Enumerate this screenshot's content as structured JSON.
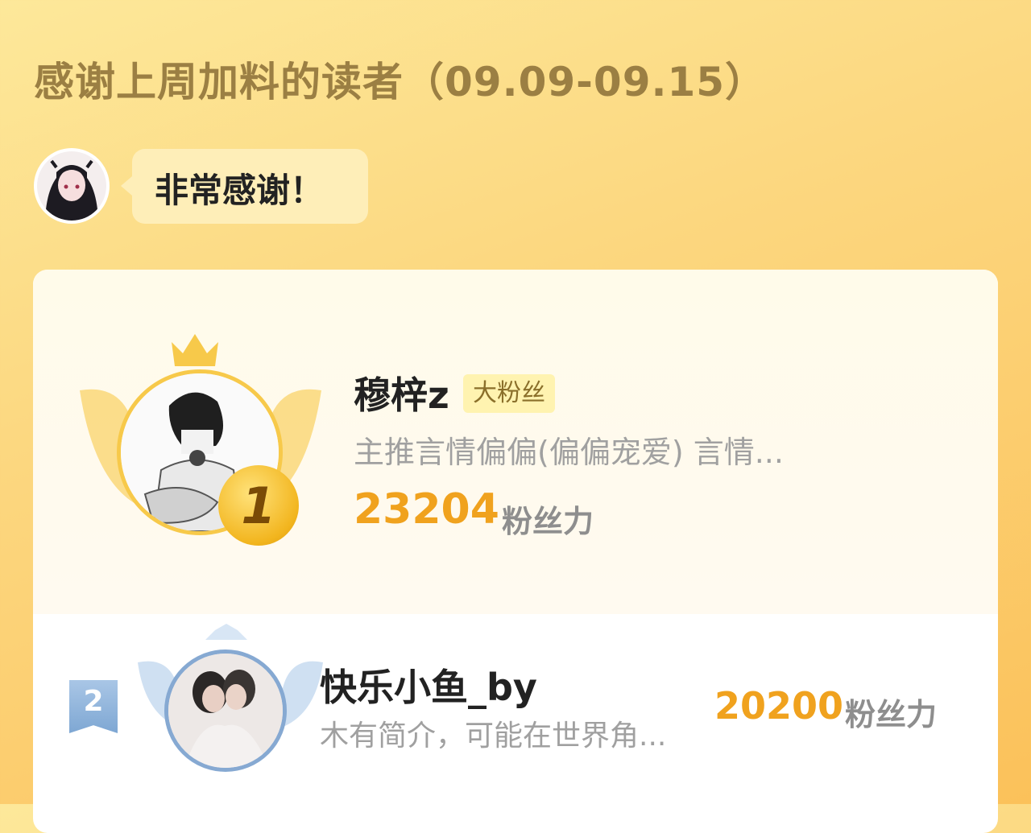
{
  "header": {
    "title": "感谢上周加料的读者（09.09-09.15）"
  },
  "author_message": {
    "text": "非常感谢！"
  },
  "ranking": [
    {
      "rank": "1",
      "name": "穆梓z",
      "tag": "大粉丝",
      "intro": "主推言情偏偏(偏偏宠爱) 言情...",
      "score": "23204",
      "unit": "粉丝力"
    },
    {
      "rank": "2",
      "name": "快乐小鱼_by",
      "intro": "木有简介，可能在世界角...",
      "score": "20200",
      "unit": "粉丝力"
    }
  ],
  "colors": {
    "accent_gold": "#f0a21e",
    "title_brown": "#9b7f43",
    "silver_blue": "#86a9d2"
  }
}
